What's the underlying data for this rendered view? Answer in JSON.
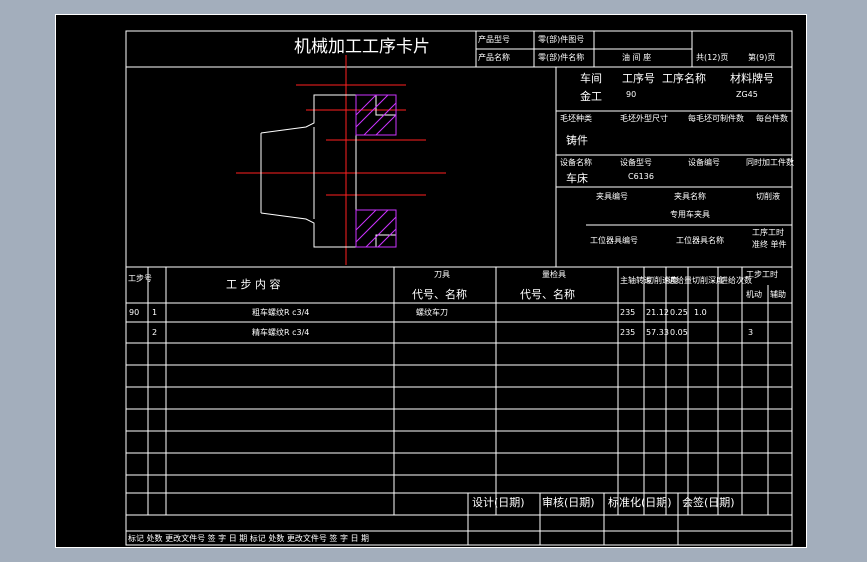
{
  "title": "机械加工工序卡片",
  "product_model_label": "产品型号",
  "part_drawing_no_label": "零(部)件图号",
  "product_name_label": "产品名称",
  "part_name_label": "零(部)件名称",
  "part_name_value": "油 间 座",
  "sheet_count": "共(12)页",
  "sheet_no": "第(9)页",
  "workshop_label": "车间",
  "operation_no_label": "工序号",
  "operation_name_label": "工序名称",
  "material_label": "材料牌号",
  "workshop_value": "金工",
  "operation_no_value": "90",
  "material_value": "ZG45",
  "blank_type_label": "毛坯种类",
  "blank_size_label": "毛坯外型尺寸",
  "blanks_per_label": "每毛坯可制件数",
  "per_machine_label": "每台件数",
  "blank_type_value": "铸件",
  "equipment_name_label": "设备名称",
  "equipment_model_label": "设备型号",
  "equipment_no_label": "设备编号",
  "simultaneous_label": "同时加工件数",
  "equipment_name_value": "车床",
  "equipment_model_value": "C6136",
  "fixture_no_label": "夹具编号",
  "fixture_name_label": "夹具名称",
  "coolant_label": "切削液",
  "fixture_name_value": "专用车夹具",
  "station_tool_no_label": "工位器具编号",
  "station_tool_name_label": "工位器具名称",
  "time_label": "工序工时",
  "time_sub": "准终 单件",
  "columns": {
    "op_no": "工步号",
    "content": "工 步 内 容",
    "cutter": "刀具",
    "cutter_sub": "代号、名称",
    "gauge": "量检具",
    "gauge_sub": "代号、名称",
    "spindle": "主轴转速",
    "cut_speed": "切削速度",
    "feed": "进给量",
    "depth": "切削深度",
    "passes": "进给次数",
    "step_time": "工步工时",
    "machine": "机动",
    "aux": "辅助"
  },
  "rows": [
    {
      "op": "90",
      "step": "1",
      "content": "粗车螺纹R c3/4",
      "cutter": "螺纹车刀",
      "spindle": "235",
      "speed": "21.12",
      "feed": "0.25",
      "depth": "1.0",
      "passes": "",
      "machine": "",
      "aux": ""
    },
    {
      "op": "",
      "step": "2",
      "content": "精车螺纹R c3/4",
      "cutter": "",
      "spindle": "235",
      "speed": "57.33",
      "feed": "0.05",
      "depth": "",
      "passes": "3",
      "machine": "",
      "aux": ""
    }
  ],
  "footer": {
    "design": "设计(日期)",
    "review": "审核(日期)",
    "standard": "标准化(日期)",
    "sign": "会签(日期)",
    "left": "标记 处数  更改文件号 签 字  日 期  标记 处数  更改文件号 签 字 日 期"
  },
  "colors": {
    "background": "#a3aebc",
    "sheet": "#000000",
    "line": "#ffffff",
    "drawing": "#ff2020",
    "hatch": "#cc33ff"
  }
}
